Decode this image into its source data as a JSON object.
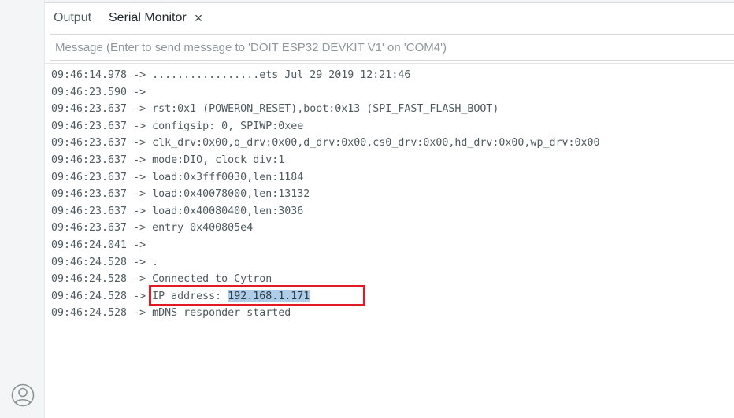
{
  "tabs": {
    "output_label": "Output",
    "serial_label": "Serial Monitor",
    "close_glyph": "×"
  },
  "message": {
    "value": "",
    "placeholder": "Message (Enter to send message to 'DOIT ESP32 DEVKIT V1' on 'COM4')"
  },
  "log": [
    {
      "time": "09:46:14.978",
      "arrow": " -> ",
      "text": ".................ets Jul 29 2019 12:21:46"
    },
    {
      "time": "09:46:23.590",
      "arrow": " ->",
      "text": ""
    },
    {
      "time": "09:46:23.637",
      "arrow": " -> ",
      "text": "rst:0x1 (POWERON_RESET),boot:0x13 (SPI_FAST_FLASH_BOOT)"
    },
    {
      "time": "09:46:23.637",
      "arrow": " -> ",
      "text": "configsip: 0, SPIWP:0xee"
    },
    {
      "time": "09:46:23.637",
      "arrow": " -> ",
      "text": "clk_drv:0x00,q_drv:0x00,d_drv:0x00,cs0_drv:0x00,hd_drv:0x00,wp_drv:0x00"
    },
    {
      "time": "09:46:23.637",
      "arrow": " -> ",
      "text": "mode:DIO, clock div:1"
    },
    {
      "time": "09:46:23.637",
      "arrow": " -> ",
      "text": "load:0x3fff0030,len:1184"
    },
    {
      "time": "09:46:23.637",
      "arrow": " -> ",
      "text": "load:0x40078000,len:13132"
    },
    {
      "time": "09:46:23.637",
      "arrow": " -> ",
      "text": "load:0x40080400,len:3036"
    },
    {
      "time": "09:46:23.637",
      "arrow": " -> ",
      "text": "entry 0x400805e4"
    },
    {
      "time": "09:46:24.041",
      "arrow": " ->",
      "text": ""
    },
    {
      "time": "09:46:24.528",
      "arrow": " -> ",
      "text": "."
    },
    {
      "time": "09:46:24.528",
      "arrow": " -> ",
      "text": "Connected to Cytron"
    },
    {
      "time": "09:46:24.528",
      "arrow": " -> ",
      "text": "IP address: ",
      "selected": "192.168.1.171"
    },
    {
      "time": "09:46:24.528",
      "arrow": " -> ",
      "text": "mDNS responder started"
    }
  ],
  "colors": {
    "annotation_box": "#e01b24",
    "selection": "#aecde9",
    "sidebar_bg": "#f4f5f6"
  },
  "icons": {
    "account": "account-icon"
  }
}
